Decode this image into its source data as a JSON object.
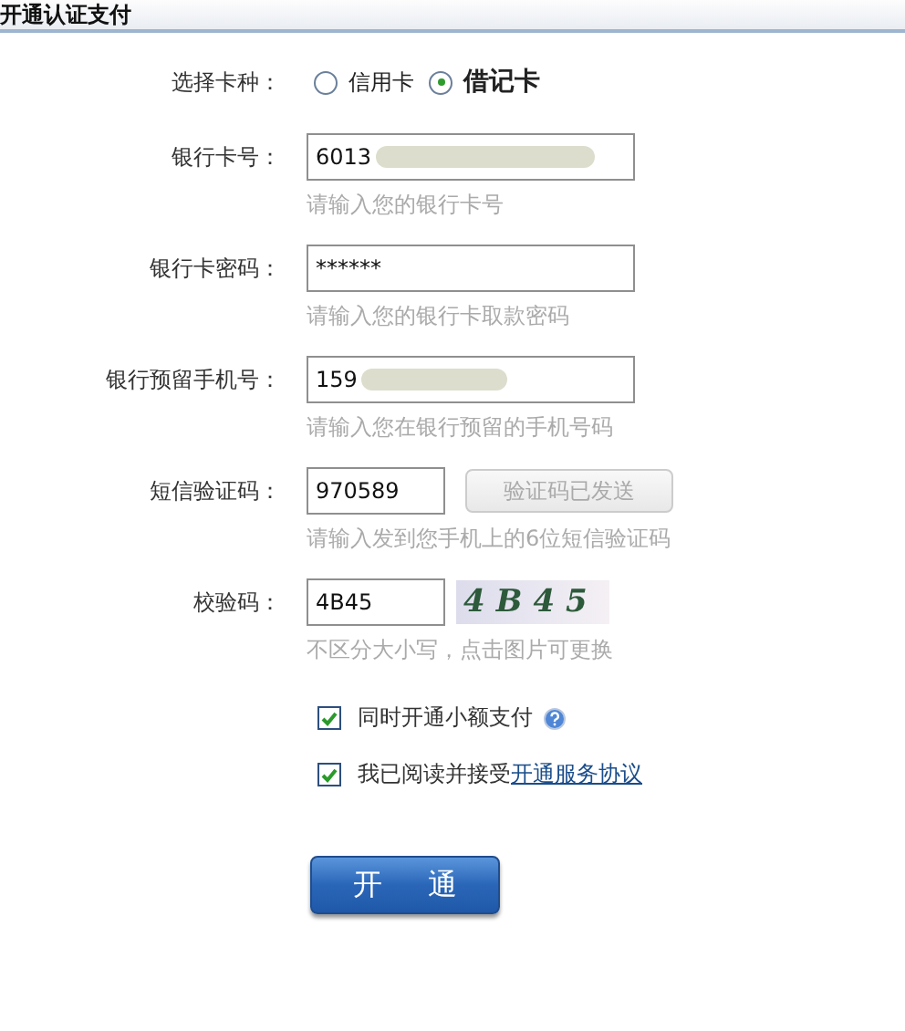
{
  "title": "开通认证支付",
  "card_type": {
    "label": "选择卡种：",
    "options": [
      {
        "label": "信用卡",
        "selected": false
      },
      {
        "label": "借记卡",
        "selected": true
      }
    ]
  },
  "fields": [
    {
      "kind": "text",
      "label": "银行卡号：",
      "value": "6013",
      "masked": true,
      "hint": "请输入您的银行卡号"
    },
    {
      "kind": "text",
      "label": "银行卡密码：",
      "value": "******",
      "masked": false,
      "hint": "请输入您的银行卡取款密码"
    },
    {
      "kind": "text",
      "label": "银行预留手机号：",
      "value": "159",
      "masked": true,
      "hint": "请输入您在银行预留的手机号码"
    },
    {
      "kind": "sms",
      "label": "短信验证码：",
      "value": "970589",
      "hint": "请输入发到您手机上的6位短信验证码",
      "button": {
        "label": "验证码已发送",
        "disabled": true
      }
    },
    {
      "kind": "captcha",
      "label": "校验码：",
      "value": "4B45",
      "hint": "不区分大小写，点击图片可更换",
      "captcha_text": "4B45"
    }
  ],
  "options": [
    {
      "label": "同时开通小额支付",
      "checked": true,
      "help": true
    },
    {
      "label": "我已阅读并接受",
      "link": "开通服务协议",
      "checked": true,
      "help": false
    }
  ],
  "submit": "开 通"
}
